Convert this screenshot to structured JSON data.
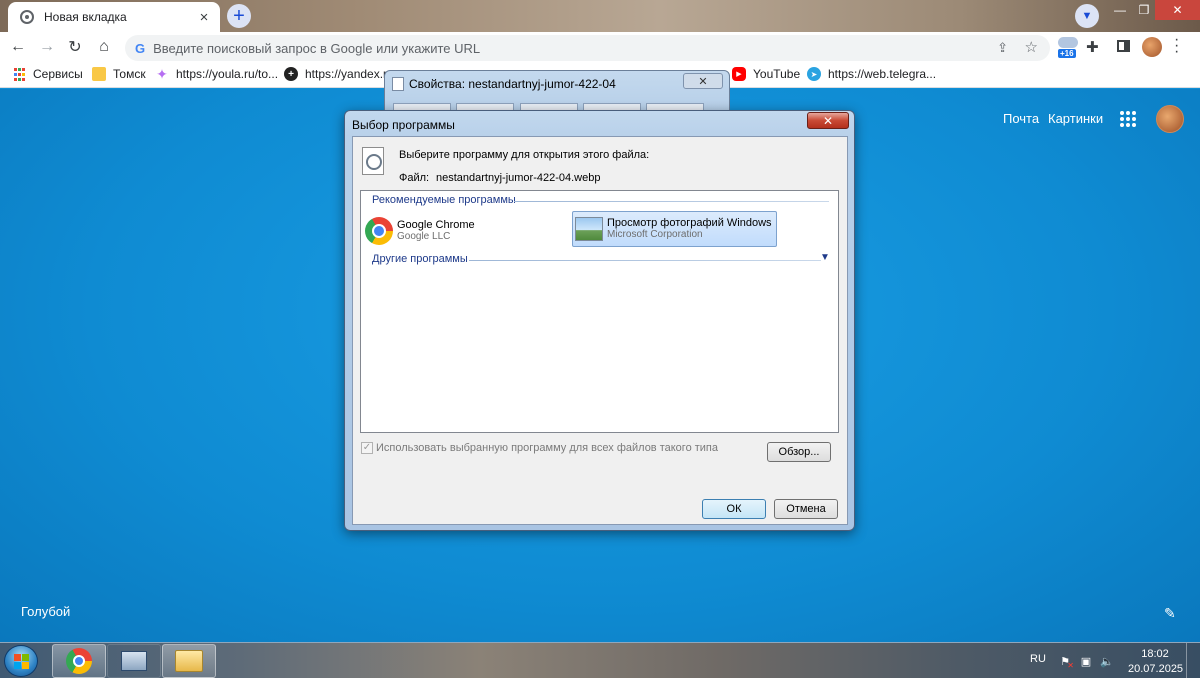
{
  "browser": {
    "tab_title": "Новая вкладка",
    "omnibox_placeholder": "Введите поисковый запрос в Google или укажите URL",
    "omnibox_value": "",
    "weather_badge": "+16",
    "bookmarks": [
      {
        "label": "Сервисы",
        "icon": "apps-grid-icon"
      },
      {
        "label": "Томск",
        "icon": "folder-icon"
      },
      {
        "label": "https://youla.ru/to...",
        "icon": "sparkle-icon"
      },
      {
        "label": "https://yandex.ru",
        "icon": "yandex-icon"
      },
      {
        "label": "YouTube",
        "icon": "youtube-icon"
      },
      {
        "label": "https://web.telegra...",
        "icon": "telegram-icon"
      }
    ]
  },
  "ntp": {
    "mail_link": "Почта",
    "images_link": "Картинки",
    "theme_name": "Голубой"
  },
  "properties_window": {
    "title": "Свойства: nestandartnyj-jumor-422-04"
  },
  "dialog": {
    "title": "Выбор программы",
    "prompt": "Выберите программу для открытия этого файла:",
    "file_label": "Файл:",
    "file_name": "nestandartnyj-jumor-422-04.webp",
    "recommended_header": "Рекомендуемые программы",
    "other_header": "Другие программы",
    "programs": [
      {
        "name": "Google Chrome",
        "vendor": "Google LLC",
        "selected": false
      },
      {
        "name": "Просмотр фотографий Windows",
        "vendor": "Microsoft Corporation",
        "selected": true
      }
    ],
    "always_use_label": "Использовать выбранную программу для всех файлов такого типа",
    "always_use_checked": true,
    "browse_button": "Обзор...",
    "ok_button": "ОК",
    "cancel_button": "Отмена"
  },
  "taskbar": {
    "language": "RU",
    "time": "18:02",
    "date": "20.07.2025"
  },
  "colors": {
    "ntp_background": "#0f8fd6",
    "selection_highlight": "#c1dcfc",
    "close_button_red": "#c94a35"
  }
}
